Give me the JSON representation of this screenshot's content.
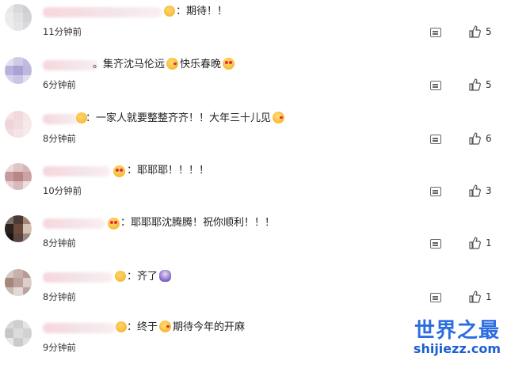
{
  "comments": [
    {
      "content": "：期待！！",
      "time": "11分钟前",
      "likes": "5",
      "avatar_colors": [
        "#e8e8ea",
        "#d9d9dc",
        "#cfcfd2",
        "#ececee",
        "#e1e1e3",
        "#d3d3d6",
        "#ededf0",
        "#e5e5e7",
        "#dadadd"
      ]
    },
    {
      "content_a": "。集齐沈马伦远",
      "content_b": "快乐春晚",
      "time": "6分钟前",
      "likes": "5",
      "avatar_colors": [
        "#e2dff0",
        "#cfcbe6",
        "#c2bde0",
        "#b8b2dc",
        "#a9a2d3",
        "#bdb8de",
        "#d4d1ea",
        "#c9c5e4",
        "#e0ddef"
      ]
    },
    {
      "content_a": "：一家人就要整整齐齐！！大年三十儿见",
      "time": "8分钟前",
      "likes": "6",
      "avatar_colors": [
        "#f4e1e3",
        "#f1d8db",
        "#f6e5e7",
        "#efd4d8",
        "#f3dcdf",
        "#f7e8ea",
        "#f2dbde",
        "#f5e3e5",
        "#f8eaec"
      ]
    },
    {
      "content": "：耶耶耶！！！！",
      "time": "10分钟前",
      "likes": "3",
      "avatar_colors": [
        "#ecd7d9",
        "#e0c4c6",
        "#d7b5b7",
        "#c89a9d",
        "#b88689",
        "#caa2a4",
        "#e6cfd1",
        "#d9bbbd",
        "#efdedf"
      ]
    },
    {
      "content": "：耶耶耶沈腾腾！祝你顺利！！！",
      "time": "8分钟前",
      "likes": "1",
      "avatar_colors": [
        "#7a6c66",
        "#4b3b34",
        "#a28474",
        "#2b2220",
        "#6b4a3c",
        "#d7c2b6",
        "#1c1513",
        "#5a463e",
        "#9b877d"
      ]
    },
    {
      "content": "：齐了",
      "time": "8分钟前",
      "likes": "1",
      "avatar_colors": [
        "#d6c8c4",
        "#c7b2ab",
        "#b69b92",
        "#a4877d",
        "#bda29a",
        "#dccfcb",
        "#cab8b2",
        "#e3d8d5",
        "#b9a59e"
      ]
    },
    {
      "content_a": "：终于",
      "content_b": "期待今年的开麻",
      "time": "9分钟前",
      "likes": "",
      "avatar_colors": [
        "#d9d9d9",
        "#cfcfcf",
        "#e4e4e4",
        "#c6c6c6",
        "#dcdcdc",
        "#d2d2d2",
        "#e8e8e8",
        "#cbcbcb",
        "#dfdfdf"
      ]
    }
  ],
  "watermark": {
    "title": "世界之最",
    "url": "shijiezz.com"
  },
  "icons": {
    "reply": "reply-icon",
    "like": "thumbs-up-icon"
  },
  "colors": {
    "watermark": "#2c6de0",
    "text": "#222222",
    "meta": "#333333"
  }
}
